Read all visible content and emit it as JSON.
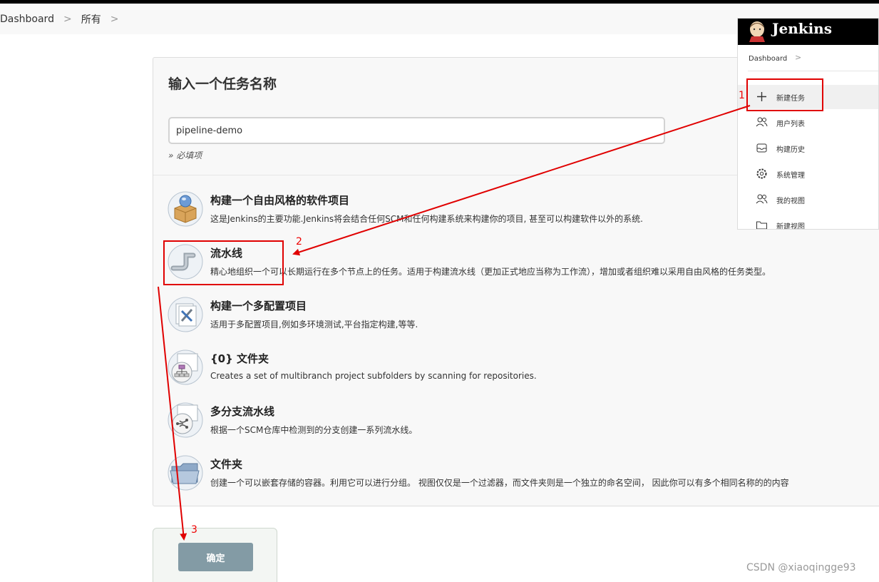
{
  "breadcrumb": {
    "items": [
      "Dashboard",
      "所有"
    ],
    "separator": ">"
  },
  "form": {
    "title": "输入一个任务名称",
    "name_value": "pipeline-demo",
    "required_note": "» 必填项"
  },
  "job_types": [
    {
      "title": "构建一个自由风格的软件项目",
      "desc": "这是Jenkins的主要功能.Jenkins将会结合任何SCM和任何构建系统来构建你的项目, 甚至可以构建软件以外的系统.",
      "icon": "freestyle-project-icon"
    },
    {
      "title": "流水线",
      "desc": "精心地组织一个可以长期运行在多个节点上的任务。适用于构建流水线（更加正式地应当称为工作流），增加或者组织难以采用自由风格的任务类型。",
      "icon": "pipeline-icon"
    },
    {
      "title": "构建一个多配置项目",
      "desc": "适用于多配置项目,例如多环境测试,平台指定构建,等等.",
      "icon": "multi-config-project-icon"
    },
    {
      "title": "{0} 文件夹",
      "desc": "Creates a set of multibranch project subfolders by scanning for repositories.",
      "icon": "organization-folder-icon"
    },
    {
      "title": "多分支流水线",
      "desc": "根据一个SCM仓库中检测到的分支创建一系列流水线。",
      "icon": "multibranch-pipeline-icon"
    },
    {
      "title": "文件夹",
      "desc": "创建一个可以嵌套存储的容器。利用它可以进行分组。 视图仅仅是一个过滤器，而文件夹则是一个独立的命名空间， 因此你可以有多个相同名称的的内容",
      "icon": "folder-icon"
    }
  ],
  "ok_button": {
    "label": "确定"
  },
  "inset": {
    "logo": "Jenkins",
    "breadcrumb": "Dashboard",
    "breadcrumb_sep": ">",
    "menu": [
      {
        "label": "新建任务",
        "icon": "plus-icon"
      },
      {
        "label": "用户列表",
        "icon": "users-icon"
      },
      {
        "label": "构建历史",
        "icon": "inbox-icon"
      },
      {
        "label": "系统管理",
        "icon": "gear-icon"
      },
      {
        "label": "我的视图",
        "icon": "people-icon"
      },
      {
        "label": "新建视图",
        "icon": "folder-outline-icon"
      }
    ]
  },
  "annotations": {
    "step1": "1",
    "step2": "2",
    "step3": "3",
    "color": "#e00000"
  },
  "watermark": "CSDN @xiaoqingge93"
}
